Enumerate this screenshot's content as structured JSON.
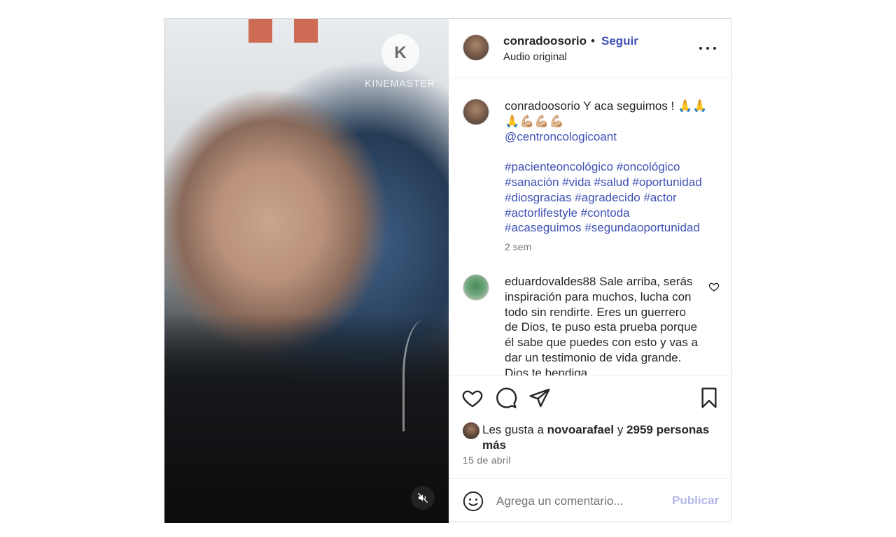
{
  "media": {
    "watermark_letter": "K",
    "watermark_text": "KINEMASTER",
    "mute_icon": "speaker-muted-icon"
  },
  "header": {
    "username": "conradoosorio",
    "separator": "•",
    "follow_label": "Seguir",
    "audio_label": "Audio original",
    "more_icon": "more-options-icon"
  },
  "caption": {
    "username": "conradoosorio",
    "text": "Y aca seguimos ! 🙏🙏🙏💪🏼💪🏼💪🏼",
    "mention": "@centroncologicoant",
    "hashtags_lines": [
      "#pacienteoncológico #oncológico",
      "#sanación #vida #salud #oportunidad",
      "#diosgracias #agradecido #actor",
      "#actorlifestyle #contoda",
      "#acaseguimos #segundaoportunidad"
    ],
    "time_ago": "2 sem"
  },
  "comment": {
    "username": "eduardovaldes88",
    "text": "Sale arriba, serás inspiración para muchos, lucha con todo sin rendirte. Eres un guerrero de Dios, te puso esta prueba porque él sabe que puedes con esto y vas a dar un testimonio de vida grande. Dios te bendiga"
  },
  "likes": {
    "prefix": "Les gusta a",
    "user": "novoarafael",
    "joiner": "y",
    "count_text": "2959 personas más"
  },
  "date": "15 de abril",
  "composer": {
    "placeholder": "Agrega un comentario...",
    "publish_label": "Publicar"
  },
  "colors": {
    "link_blue": "#3f51b5",
    "publish_disabled": "#b2b9ea",
    "secondary_text": "#737373",
    "border": "#dbdbdb"
  }
}
